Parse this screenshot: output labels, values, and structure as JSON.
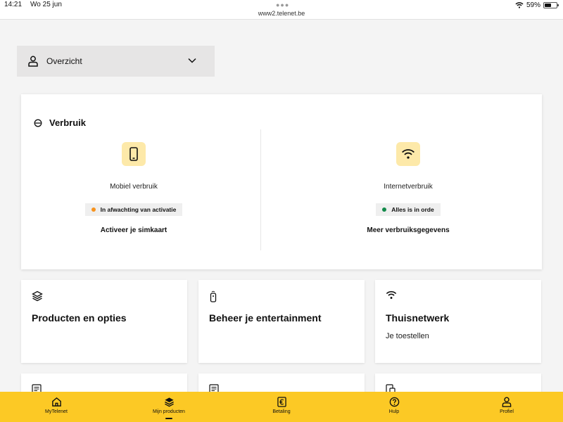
{
  "statusbar": {
    "time": "14:21",
    "date": "Wo 25 jun",
    "url": "www2.telenet.be",
    "battery": "59%",
    "battery_level": 0.59
  },
  "overview": {
    "label": "Overzicht"
  },
  "usage": {
    "title": "Verbruik",
    "mobile": {
      "label": "Mobiel verbruik",
      "status": "In afwachting van activatie",
      "status_color": "#f7931e",
      "link": "Activeer je simkaart"
    },
    "internet": {
      "label": "Internetverbruik",
      "status": "Alles is in orde",
      "status_color": "#128a4a",
      "link": "Meer verbruiksgegevens"
    }
  },
  "tiles": [
    {
      "title": "Producten en opties",
      "icon": "layers-icon"
    },
    {
      "title": "Beheer je entertainment",
      "icon": "remote-icon"
    },
    {
      "title": "Thuisnetwerk",
      "subtitle": "Je toestellen",
      "icon": "wifi-icon"
    }
  ],
  "nav": {
    "items": [
      {
        "label": "MyTelenet",
        "icon": "home-icon"
      },
      {
        "label": "Mijn producten",
        "icon": "layers-icon",
        "active": true
      },
      {
        "label": "Betaling",
        "icon": "euro-icon"
      },
      {
        "label": "Hulp",
        "icon": "help-icon"
      },
      {
        "label": "Profiel",
        "icon": "profile-icon"
      }
    ]
  },
  "colors": {
    "accent": "#fcc925",
    "tile_icon_bg": "#fde9a9",
    "page_bg": "#f4f4f4"
  }
}
